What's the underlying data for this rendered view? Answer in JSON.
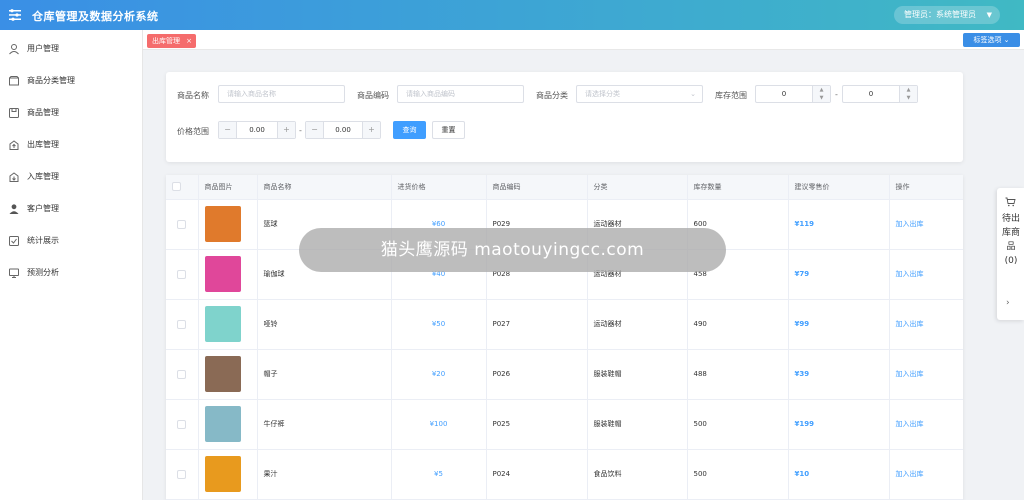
{
  "header": {
    "title": "仓库管理及数据分析系统",
    "user_label": "管理员：系统管理员",
    "caret": "▼"
  },
  "sidebar": {
    "items": [
      {
        "label": "用户管理",
        "icon": "user-icon"
      },
      {
        "label": "商品分类管理",
        "icon": "category-icon"
      },
      {
        "label": "商品管理",
        "icon": "product-icon"
      },
      {
        "label": "出库管理",
        "icon": "outbound-icon"
      },
      {
        "label": "入库管理",
        "icon": "inbound-icon"
      },
      {
        "label": "客户管理",
        "icon": "customer-icon"
      },
      {
        "label": "统计展示",
        "icon": "stats-icon"
      },
      {
        "label": "预测分析",
        "icon": "monitor-icon"
      }
    ]
  },
  "tabs": {
    "active": "出库管理",
    "close": "×",
    "options_label": "标签选项 ⌄"
  },
  "filters": {
    "name_label": "商品名称",
    "name_placeholder": "请输入商品名称",
    "code_label": "商品编码",
    "code_placeholder": "请输入商品编码",
    "category_label": "商品分类",
    "category_placeholder": "请选择分类",
    "stock_label": "库存范围",
    "stock_min": "0",
    "stock_max": "0",
    "price_label": "价格范围",
    "price_min": "0.00",
    "price_max": "0.00",
    "dash": "-",
    "minus": "−",
    "plus": "+",
    "query_label": "查询",
    "reset_label": "重置"
  },
  "table": {
    "headers": [
      "商品图片",
      "商品名称",
      "进货价格",
      "商品编码",
      "分类",
      "库存数量",
      "建议零售价",
      "操作"
    ],
    "rows": [
      {
        "name": "篮球",
        "cost": "¥60",
        "code": "P029",
        "category": "运动器材",
        "stock": "600",
        "retail": "¥119",
        "action": "加入出库",
        "thumb": "#e07a2c"
      },
      {
        "name": "瑜伽球",
        "cost": "¥40",
        "code": "P028",
        "category": "运动器材",
        "stock": "458",
        "retail": "¥79",
        "action": "加入出库",
        "thumb": "#e0479a"
      },
      {
        "name": "哑铃",
        "cost": "¥50",
        "code": "P027",
        "category": "运动器材",
        "stock": "490",
        "retail": "¥99",
        "action": "加入出库",
        "thumb": "#7fd3cc"
      },
      {
        "name": "帽子",
        "cost": "¥20",
        "code": "P026",
        "category": "服装鞋帽",
        "stock": "488",
        "retail": "¥39",
        "action": "加入出库",
        "thumb": "#8a6a55"
      },
      {
        "name": "牛仔裤",
        "cost": "¥100",
        "code": "P025",
        "category": "服装鞋帽",
        "stock": "500",
        "retail": "¥199",
        "action": "加入出库",
        "thumb": "#86b9c7"
      },
      {
        "name": "果汁",
        "cost": "¥5",
        "code": "P024",
        "category": "食品饮料",
        "stock": "500",
        "retail": "¥10",
        "action": "加入出库",
        "thumb": "#e89a1e"
      }
    ]
  },
  "cart_panel": {
    "label": "待出库商品(0)",
    "arrow": "›"
  },
  "watermark": {
    "text": "猫头鹰源码 maotouyingcc.com"
  }
}
